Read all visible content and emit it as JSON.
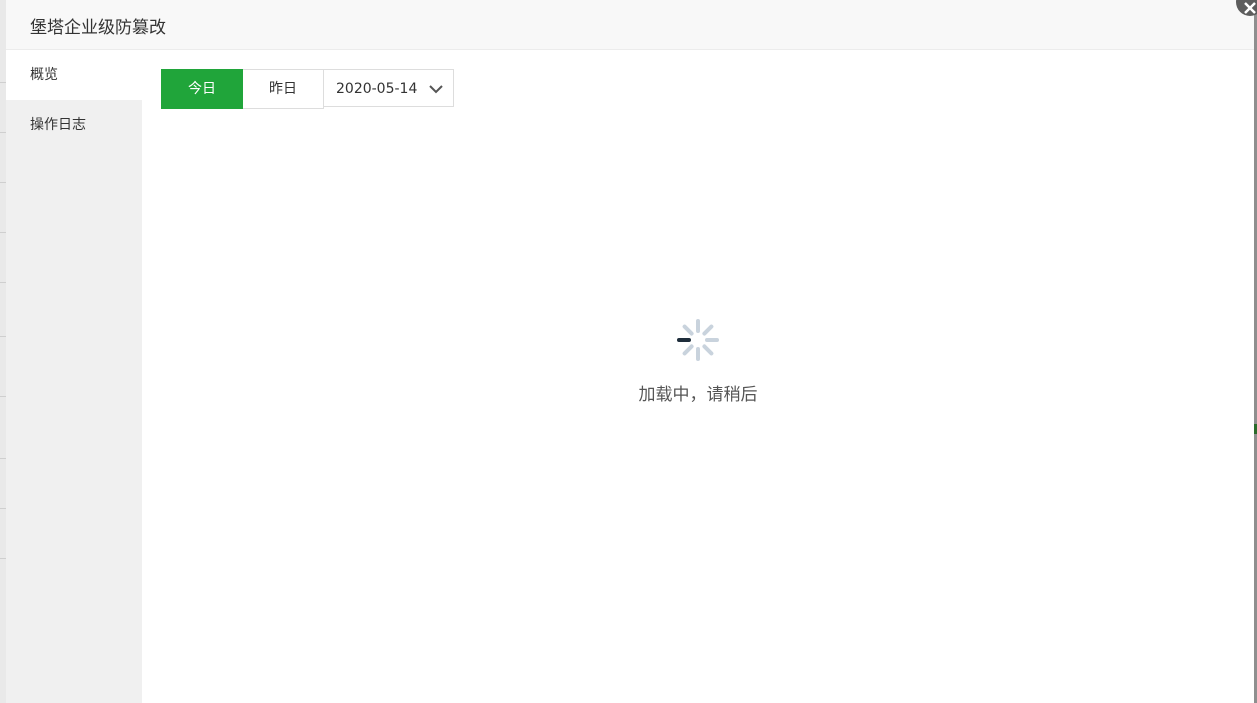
{
  "dialog": {
    "title": "堡塔企业级防篡改",
    "close_icon": "close-icon"
  },
  "sidebar": {
    "items": [
      {
        "label": "概览",
        "active": true
      },
      {
        "label": "操作日志",
        "active": false
      }
    ]
  },
  "filters": {
    "today_label": "今日",
    "yesterday_label": "昨日",
    "selected_date": "2020-05-14",
    "active_color": "#20a53a"
  },
  "loading": {
    "icon": "spinner-icon",
    "text": "加载中，请稍后"
  }
}
